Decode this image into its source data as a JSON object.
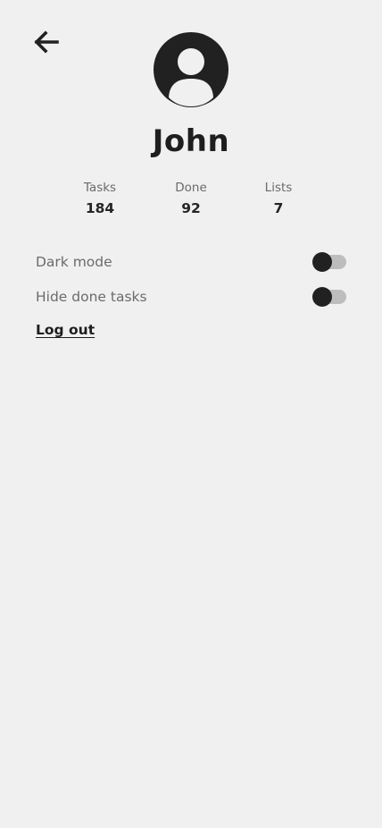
{
  "header": {
    "back_icon": "arrow-left-icon"
  },
  "profile": {
    "avatar_icon": "user-avatar-icon",
    "name": "John"
  },
  "stats": [
    {
      "label": "Tasks",
      "value": "184"
    },
    {
      "label": "Done",
      "value": "92"
    },
    {
      "label": "Lists",
      "value": "7"
    }
  ],
  "settings": [
    {
      "label": "Dark mode",
      "enabled": false
    },
    {
      "label": "Hide done tasks",
      "enabled": false
    }
  ],
  "actions": {
    "logout_label": "Log out"
  },
  "colors": {
    "background": "#f0f0f0",
    "primary": "#212121",
    "muted_text": "#6b6b6b",
    "toggle_track": "#bdbdbd"
  }
}
